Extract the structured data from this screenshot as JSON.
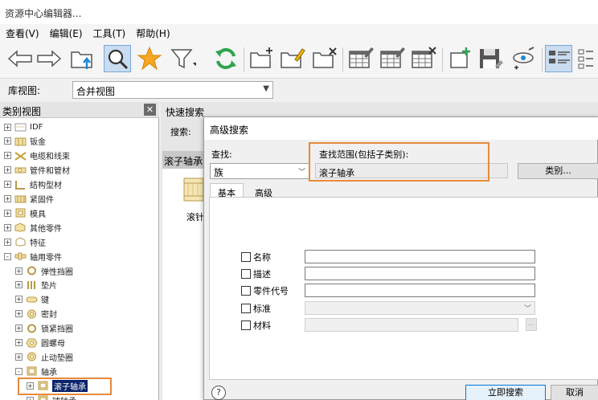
{
  "window": {
    "title": "资源中心编辑器..."
  },
  "menu": [
    "查看(V)",
    "编辑(E)",
    "工具(T)",
    "帮助(H)"
  ],
  "toolbar": {
    "icons": [
      "back-arrow-icon",
      "forward-arrow-icon",
      "folder-up-icon",
      "search-icon",
      "favorite-star-icon",
      "filter-icon",
      "refresh-icon",
      "new-folder-icon",
      "edit-folder-icon",
      "delete-folder-icon",
      "edit-table-icon",
      "edit-table-2-icon",
      "delete-table-icon",
      "add-item-icon",
      "save-icon",
      "tools-icon",
      "list-view-icon",
      "detail-view-icon"
    ]
  },
  "library": {
    "label": "库视图:",
    "value": "合并视图"
  },
  "category_panel": {
    "title": "类别视图",
    "items": [
      {
        "label": "IDF",
        "level": 0,
        "expand": "+"
      },
      {
        "label": "钣金",
        "level": 0,
        "expand": "+"
      },
      {
        "label": "电缆和线束",
        "level": 0,
        "expand": "+"
      },
      {
        "label": "管件和管材",
        "level": 0,
        "expand": "+"
      },
      {
        "label": "结构型材",
        "level": 0,
        "expand": "+"
      },
      {
        "label": "紧固件",
        "level": 0,
        "expand": "+"
      },
      {
        "label": "模具",
        "level": 0,
        "expand": "+"
      },
      {
        "label": "其他零件",
        "level": 0,
        "expand": "+"
      },
      {
        "label": "特征",
        "level": 0,
        "expand": "+"
      },
      {
        "label": "轴用零件",
        "level": 0,
        "expand": "-"
      },
      {
        "label": "弹性挡圈",
        "level": 1,
        "expand": "+"
      },
      {
        "label": "垫片",
        "level": 1,
        "expand": "+"
      },
      {
        "label": "键",
        "level": 1,
        "expand": "+"
      },
      {
        "label": "密封",
        "level": 1,
        "expand": "+"
      },
      {
        "label": "锁紧挡圈",
        "level": 1,
        "expand": "+"
      },
      {
        "label": "圆螺母",
        "level": 1,
        "expand": "+"
      },
      {
        "label": "止动垫圈",
        "level": 1,
        "expand": "+"
      },
      {
        "label": "轴承",
        "level": 1,
        "expand": "-"
      },
      {
        "label": "滚子轴承",
        "level": 2,
        "expand": "+",
        "selected": true
      },
      {
        "label": "球轴承",
        "level": 2,
        "expand": "+"
      }
    ]
  },
  "quick_search": {
    "title": "快速搜索",
    "search_label": "搜索:"
  },
  "results": {
    "header": "滚子轴承",
    "item_label": "滚针"
  },
  "dialog": {
    "title": "高级搜索",
    "find_label": "查找:",
    "find_value": "族",
    "scope_label": "查找范围(包括子类别):",
    "scope_value": "滚子轴承",
    "category_button": "类别...",
    "tabs": [
      "基本",
      "高级"
    ],
    "fields": [
      "名称",
      "描述",
      "零件代号",
      "标准",
      "材料"
    ],
    "browse_button": "...",
    "help": "?",
    "search_button": "立即搜索",
    "cancel_button": "取消"
  }
}
